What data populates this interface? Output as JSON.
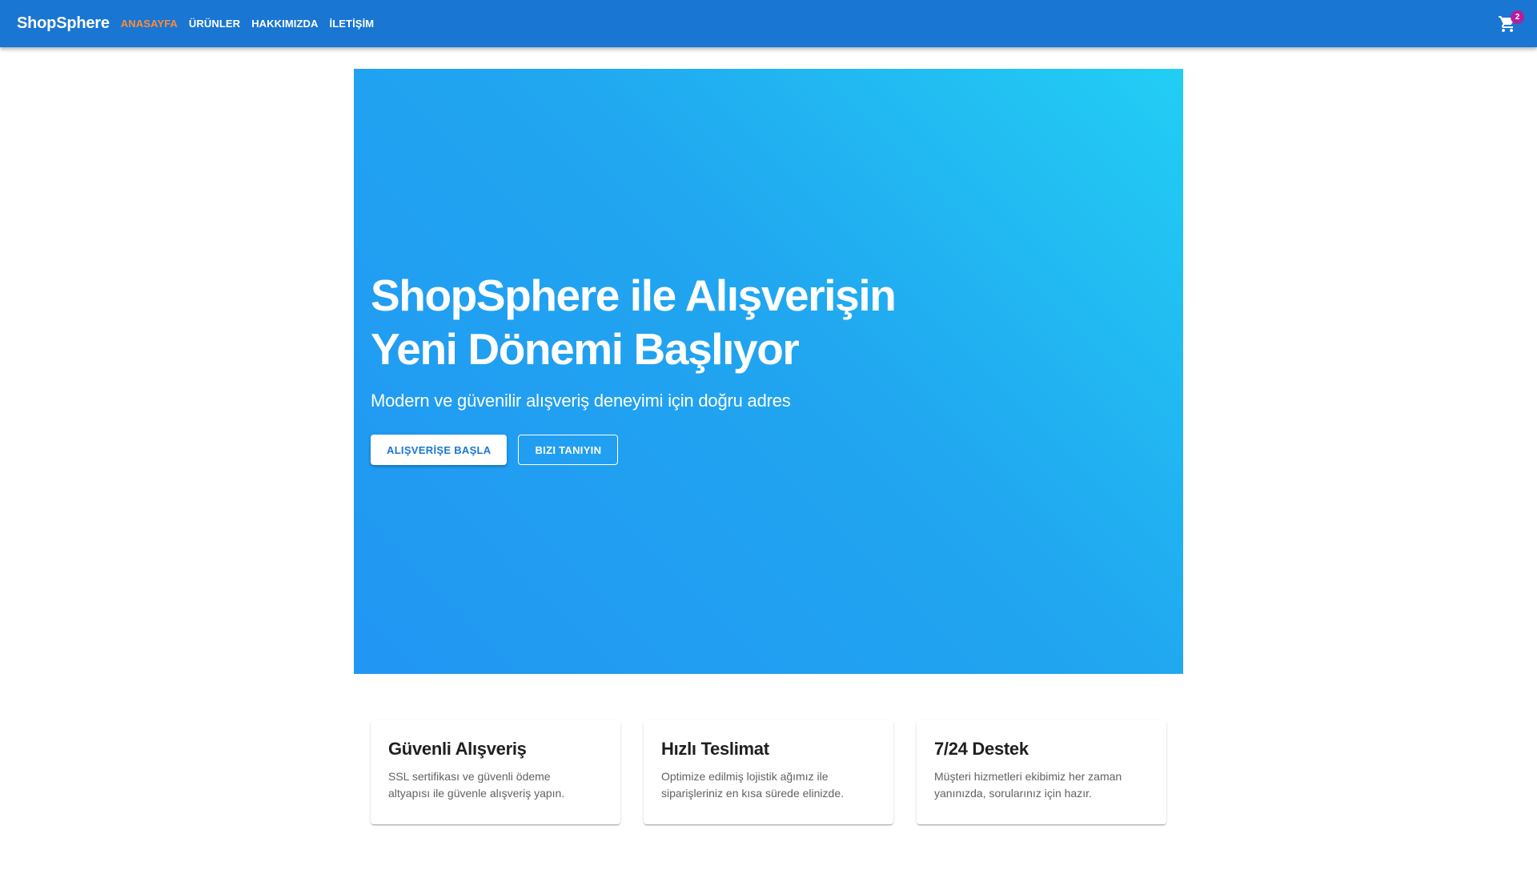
{
  "header": {
    "brand": "ShopSphere",
    "nav": [
      {
        "label": "ANASAYFA",
        "active": true
      },
      {
        "label": "ÜRÜNLER",
        "active": false
      },
      {
        "label": "HAKKIMIZDA",
        "active": false
      },
      {
        "label": "İLETİŞİM",
        "active": false
      }
    ],
    "cart_icon": "shopping-cart-icon",
    "cart_count": "2"
  },
  "hero": {
    "title_line1": "ShopSphere ile Alışverişin",
    "title_line2": "Yeni Dönemi Başlıyor",
    "subtitle": "Modern ve güvenilir alışveriş deneyimi için doğru adres",
    "primary_button": "ALIŞVERİŞE BAŞLA",
    "secondary_button": "BIZI TANIYIN"
  },
  "features": [
    {
      "title": "Güvenli Alışveriş",
      "text_line1": "SSL sertifikası ve güvenli ödeme",
      "text_line2": "altyapısı ile güvenle alışveriş yapın."
    },
    {
      "title": "Hızlı Teslimat",
      "text_line1": "Optimize edilmiş lojistik ağımız ile",
      "text_line2": "siparişleriniz en kısa sürede elinizde."
    },
    {
      "title": "7/24 Destek",
      "text_line1": "Müşteri hizmetleri ekibimiz her zaman",
      "text_line2": "yanınızda, sorularınız için hazır."
    }
  ],
  "colors": {
    "appbar": "#1976d2",
    "active_nav": "#ff8a3d",
    "hero_gradient_start": "#22cef4",
    "hero_gradient_end": "#2196f3",
    "badge": "#b51f9a"
  }
}
